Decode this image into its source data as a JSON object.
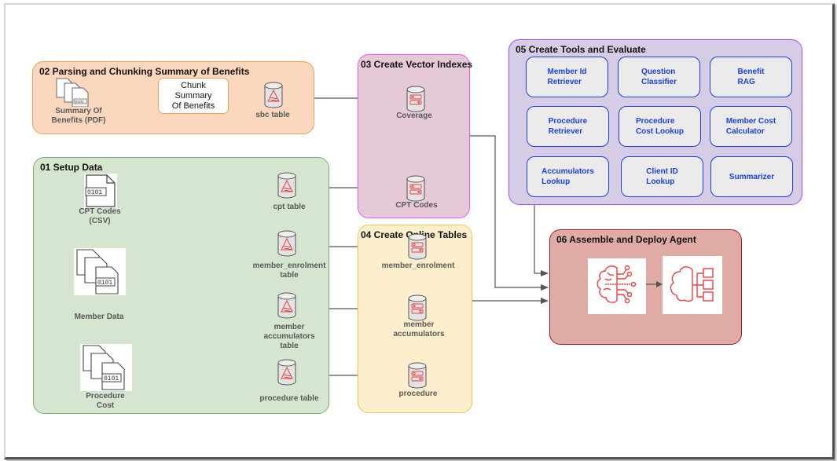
{
  "groups": {
    "parsing": {
      "title": "02 Parsing and Chunking Summary of Benefits",
      "source_label": "Summary Of\nBenefits (PDF)",
      "process_label": "Chunk\nSummary\nOf Benefits",
      "table_label": "sbc table"
    },
    "setup": {
      "title": "01 Setup Data",
      "sources": [
        {
          "label": "CPT Codes\n(CSV)"
        },
        {
          "label": "Member Data"
        },
        {
          "label": "Procedure\nCost"
        }
      ],
      "tables": [
        {
          "label": "cpt table"
        },
        {
          "label": "member_enrolment\ntable"
        },
        {
          "label": "member\naccumulators\ntable"
        },
        {
          "label": "procedure table"
        }
      ]
    },
    "vector": {
      "title": "03 Create Vector Indexes",
      "indexes": [
        {
          "label": "Coverage"
        },
        {
          "label": "CPT Codes"
        }
      ]
    },
    "online": {
      "title": "04 Create Online Tables",
      "tables": [
        {
          "label": "member_enrolment"
        },
        {
          "label": "member\naccumulators"
        },
        {
          "label": "procedure"
        }
      ]
    },
    "tools": {
      "title": "05 Create Tools and Evaluate",
      "items": [
        {
          "label": "Member Id\nRetriever"
        },
        {
          "label": "Question\nClassifier"
        },
        {
          "label": "Benefit\nRAG"
        },
        {
          "label": "Procedure\nRetriever"
        },
        {
          "label": "Procedure\nCost Lookup"
        },
        {
          "label": "Member Cost\nCalculator"
        },
        {
          "label": "Accumulators\nLookup"
        },
        {
          "label": "Client ID\nLookup"
        },
        {
          "label": "Summarizer"
        }
      ]
    },
    "deploy": {
      "title": "06 Assemble and Deploy Agent",
      "icons": [
        "ai-brain-icon",
        "cloud-deploy-icon"
      ]
    }
  },
  "colors": {
    "accent_red": "#e8403f",
    "tool_blue": "#1a3fe6",
    "wire": "#555555"
  }
}
